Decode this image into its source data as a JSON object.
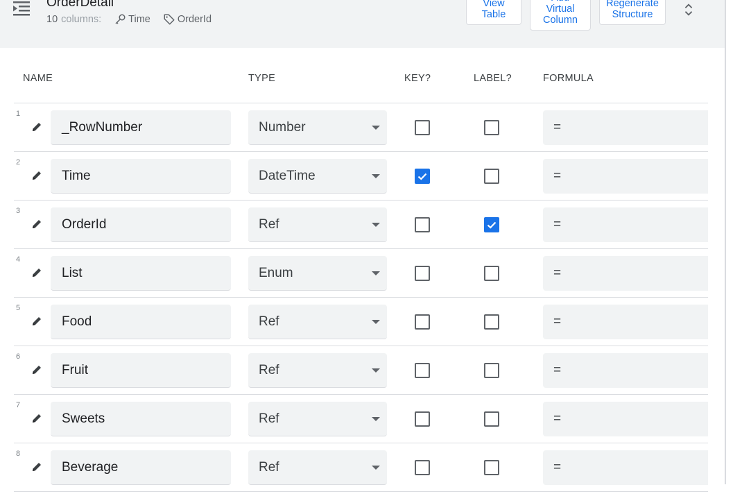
{
  "header": {
    "table_name": "OrderDetail",
    "column_count": "10",
    "columns_word": "columns:",
    "key_column": "Time",
    "label_column": "OrderId",
    "buttons": {
      "view_table": "View\nTable",
      "add_virtual_column": "Add\nVirtual\nColumn",
      "regenerate_structure": "Regenerate\nStructure"
    }
  },
  "columns_header": {
    "name": "NAME",
    "type": "TYPE",
    "key": "KEY?",
    "label": "LABEL?",
    "formula": "FORMULA"
  },
  "rows": [
    {
      "num": "1",
      "name": "_RowNumber",
      "type": "Number",
      "key": false,
      "label": false,
      "formula": "="
    },
    {
      "num": "2",
      "name": "Time",
      "type": "DateTime",
      "key": true,
      "label": false,
      "formula": "="
    },
    {
      "num": "3",
      "name": "OrderId",
      "type": "Ref",
      "key": false,
      "label": true,
      "formula": "="
    },
    {
      "num": "4",
      "name": "List",
      "type": "Enum",
      "key": false,
      "label": false,
      "formula": "="
    },
    {
      "num": "5",
      "name": "Food",
      "type": "Ref",
      "key": false,
      "label": false,
      "formula": "="
    },
    {
      "num": "6",
      "name": "Fruit",
      "type": "Ref",
      "key": false,
      "label": false,
      "formula": "="
    },
    {
      "num": "7",
      "name": "Sweets",
      "type": "Ref",
      "key": false,
      "label": false,
      "formula": "="
    },
    {
      "num": "8",
      "name": "Beverage",
      "type": "Ref",
      "key": false,
      "label": false,
      "formula": "="
    }
  ],
  "colors": {
    "accent": "#1a73e8",
    "header_bg": "#f1f3f4",
    "field_bg": "#f1f3f4",
    "divider": "#dadce0"
  }
}
